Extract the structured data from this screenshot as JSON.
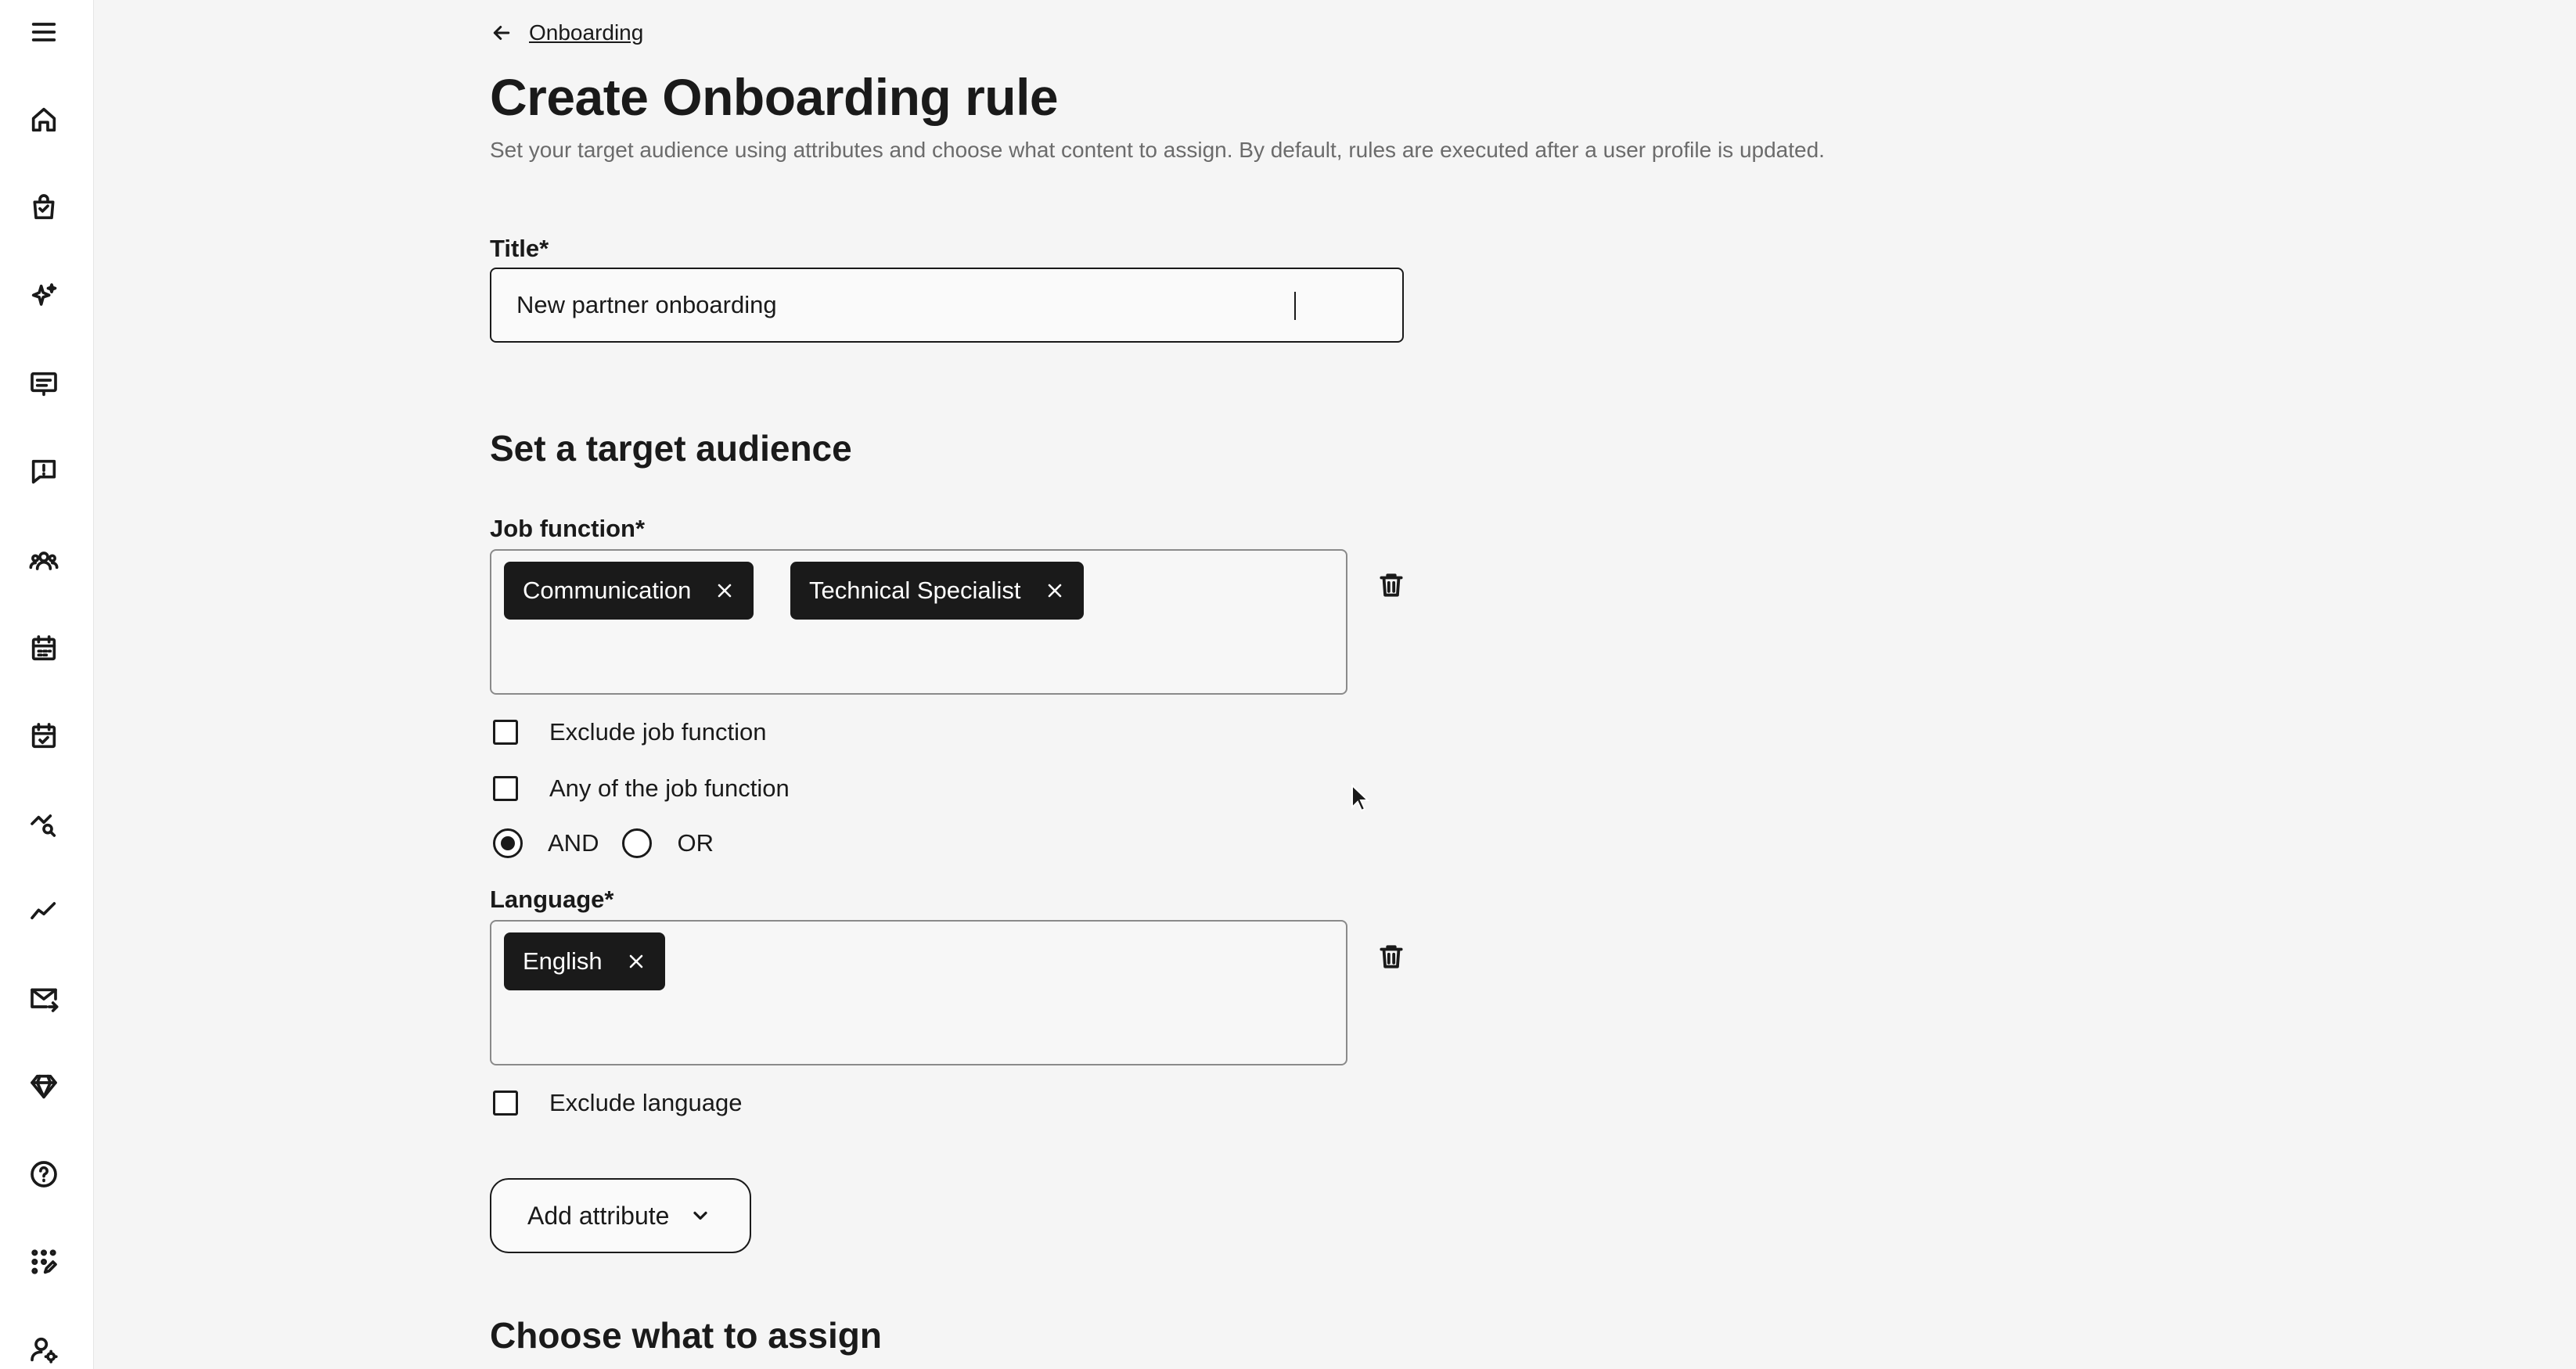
{
  "sidebar": {
    "items": [
      {
        "icon": "menu-icon"
      },
      {
        "icon": "home-icon"
      },
      {
        "icon": "shopping-bag-icon"
      },
      {
        "icon": "sparkles-icon"
      },
      {
        "icon": "presentation-icon"
      },
      {
        "icon": "feedback-icon"
      },
      {
        "icon": "users-icon"
      },
      {
        "icon": "calendar-icon"
      },
      {
        "icon": "calendar-check-icon"
      },
      {
        "icon": "analytics-search-icon"
      },
      {
        "icon": "line-chart-icon"
      },
      {
        "icon": "mail-send-icon"
      },
      {
        "icon": "diamond-icon"
      },
      {
        "icon": "help-icon"
      },
      {
        "icon": "apps-edit-icon"
      },
      {
        "icon": "user-settings-icon"
      }
    ]
  },
  "header": {
    "back_label": "Onboarding",
    "title": "Create Onboarding rule",
    "subtitle": "Set your target audience using attributes and choose what content to assign. By default, rules are executed after a user profile is updated."
  },
  "form": {
    "title_label": "Title*",
    "title_value": "New partner onboarding"
  },
  "audience": {
    "heading": "Set a target audience",
    "job_function": {
      "label": "Job function*",
      "chips": [
        "Communication",
        "Technical Specialist"
      ],
      "exclude_label": "Exclude job function",
      "any_label": "Any of the job function",
      "and_label": "AND",
      "or_label": "OR",
      "selected_operator": "AND"
    },
    "language": {
      "label": "Language*",
      "chips": [
        "English"
      ],
      "exclude_label": "Exclude language"
    },
    "add_attribute_label": "Add attribute"
  },
  "assign": {
    "heading": "Choose what to assign"
  }
}
